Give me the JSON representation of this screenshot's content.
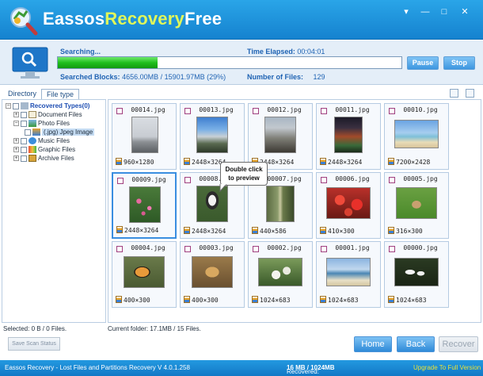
{
  "app": {
    "title_part1": "Eassos",
    "title_part2": "Recovery",
    "title_part3": "Free"
  },
  "window_controls": {
    "menu": "▾",
    "minimize": "—",
    "maximize": "□",
    "close": "✕"
  },
  "scan": {
    "status_label": "Searching...",
    "elapsed_label": "Time Elapsed:",
    "elapsed_value": "00:04:01",
    "progress_fraction": 0.29,
    "blocks_label": "Searched Blocks:",
    "blocks_value": "4656.00MB / 15901.97MB (29%)",
    "files_label": "Number of Files:",
    "files_value": "129",
    "pause_label": "Pause",
    "stop_label": "Stop"
  },
  "tabs": [
    {
      "label": "Directory",
      "active": false
    },
    {
      "label": "File type",
      "active": true
    }
  ],
  "tree": {
    "root": "Recovered Types(0)",
    "items": [
      {
        "label": "Document Files",
        "icon": "document-icon"
      },
      {
        "label": "Photo Files",
        "icon": "photo-icon"
      },
      {
        "label": "(.jpg) Jpeg Image",
        "icon": "jpeg-icon",
        "selected": true
      },
      {
        "label": "Music Files",
        "icon": "music-icon"
      },
      {
        "label": "Graphic Files",
        "icon": "graphic-icon"
      },
      {
        "label": "Archive Files",
        "icon": "archive-icon"
      }
    ]
  },
  "files": [
    {
      "name": "00014.jpg",
      "res": "960×1280"
    },
    {
      "name": "00013.jpg",
      "res": "2448×3264"
    },
    {
      "name": "00012.jpg",
      "res": "2448×3264"
    },
    {
      "name": "00011.jpg",
      "res": "2448×3264"
    },
    {
      "name": "00010.jpg",
      "res": "7200×2428"
    },
    {
      "name": "00009.jpg",
      "res": "2448×3264"
    },
    {
      "name": "00008.jpg",
      "res": "2448×3264"
    },
    {
      "name": "00007.jpg",
      "res": "440×586"
    },
    {
      "name": "00006.jpg",
      "res": "410×300"
    },
    {
      "name": "00005.jpg",
      "res": "316×300"
    },
    {
      "name": "00004.jpg",
      "res": "400×300"
    },
    {
      "name": "00003.jpg",
      "res": "400×300"
    },
    {
      "name": "00002.jpg",
      "res": "1024×683"
    },
    {
      "name": "00001.jpg",
      "res": "1024×683"
    },
    {
      "name": "00000.jpg",
      "res": "1024×683"
    }
  ],
  "tooltip": {
    "line1": "Double click",
    "line2": "to preview"
  },
  "status": {
    "selected": "Selected: 0 B / 0 Files.",
    "folder": "Current folder: 17.1MB / 15 Files."
  },
  "buttons": {
    "save_scan": "Save Scan Status",
    "home": "Home",
    "back": "Back",
    "recover": "Recover"
  },
  "footer": {
    "version": "Eassos Recovery - Lost Files and Partitions Recovery  V 4.0.1.258",
    "recovered_label": "Recovered:",
    "recovered_value": "16 MB / 1024MB",
    "upgrade": "Upgrade To Full Version"
  },
  "colors": {
    "accent": "#1f8ad8",
    "progress": "#1fbf1d",
    "upgrade": "#e8e23a"
  }
}
